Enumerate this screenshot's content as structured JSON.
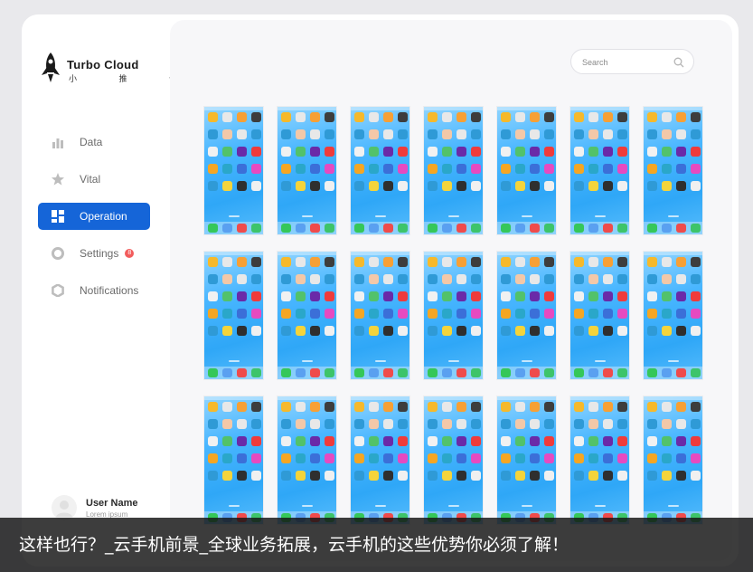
{
  "brand": {
    "name": "Turbo Cloud",
    "subtitle": "小 推 云"
  },
  "nav": {
    "items": [
      {
        "label": "Data",
        "icon": "bar-chart-icon",
        "active": false
      },
      {
        "label": "Vital",
        "icon": "star-icon",
        "active": false
      },
      {
        "label": "Operation",
        "icon": "grid-icon",
        "active": true
      },
      {
        "label": "Settings",
        "icon": "gear-icon",
        "active": false,
        "badge": "8"
      },
      {
        "label": "Notifications",
        "icon": "bell-icon",
        "active": false
      }
    ]
  },
  "user": {
    "name": "User Name",
    "role": "Lorem ipsum"
  },
  "search": {
    "placeholder": "Search"
  },
  "grid": {
    "rows": 3,
    "columns": 7
  },
  "colors": {
    "accent": "#1565d8",
    "badge": "#f25c5c",
    "phone_bg": "#3aaef8"
  },
  "caption": {
    "text": "这样也行？_云手机前景_全球业务拓展，云手机的这些优势你必须了解！"
  }
}
